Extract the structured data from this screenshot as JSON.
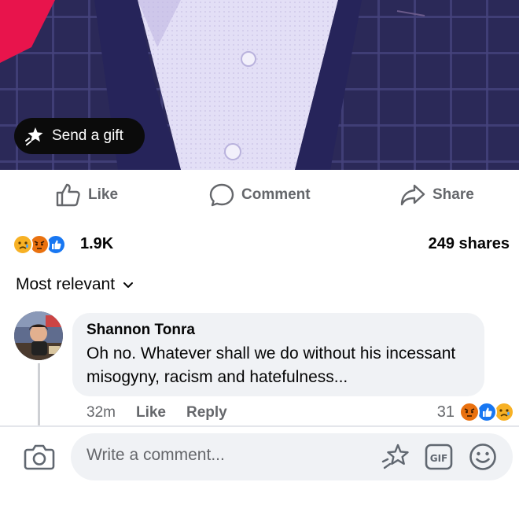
{
  "photo": {
    "gift_label": "Send a gift"
  },
  "actions": {
    "like": "Like",
    "comment": "Comment",
    "share": "Share"
  },
  "reactions": {
    "icons": [
      "sad-reaction",
      "angry-reaction",
      "like-reaction"
    ],
    "count": "1.9K",
    "shares": "249 shares"
  },
  "sort": {
    "label": "Most relevant"
  },
  "comment": {
    "author": "Shannon Tonra",
    "text": "Oh no. Whatever shall we do without his incessant misogyny, racism and hatefulness...",
    "time": "32m",
    "like": "Like",
    "reply": "Reply",
    "reaction_count": "31",
    "reaction_icons": [
      "angry-reaction",
      "like-reaction",
      "sad-reaction"
    ]
  },
  "composer": {
    "placeholder": "Write a comment..."
  },
  "colors": {
    "like_blue": "#1877f2",
    "angry": "#e9710f",
    "sad": "#f7b125",
    "muted": "#65676b"
  }
}
